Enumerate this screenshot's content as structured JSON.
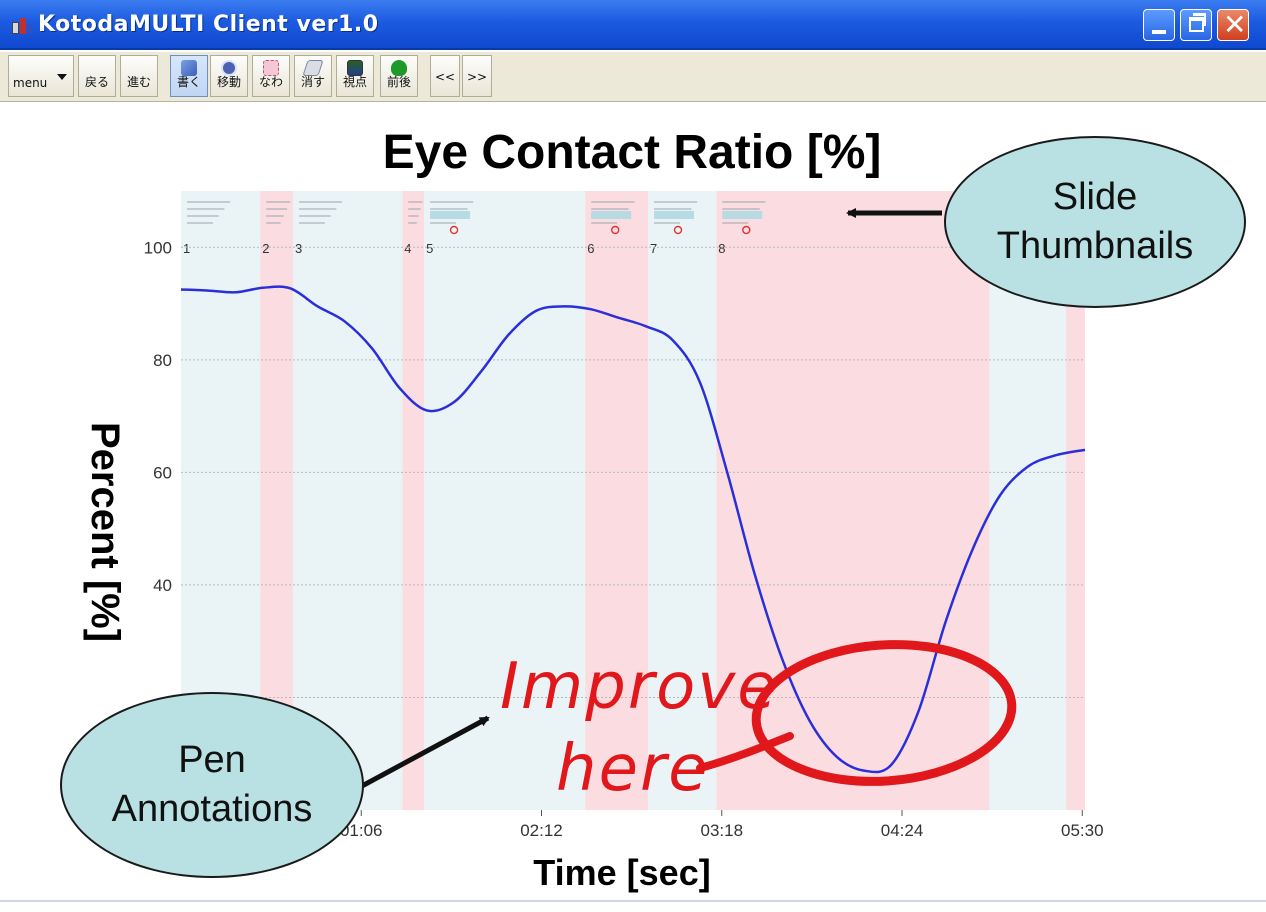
{
  "window": {
    "title": "KotodaMULTI Client ver1.0",
    "controls": {
      "close_glyph": "✕"
    }
  },
  "toolbar": {
    "buttons": [
      {
        "id": "menu",
        "label": "menu",
        "icon": "dropdown-arrow"
      },
      {
        "id": "back",
        "label": "戻る"
      },
      {
        "id": "forward",
        "label": "進む"
      },
      {
        "id": "write",
        "label": "書く",
        "icon": "pen-icon",
        "selected": true
      },
      {
        "id": "move",
        "label": "移動",
        "icon": "move-icon"
      },
      {
        "id": "lasso",
        "label": "なわ",
        "icon": "lasso-icon"
      },
      {
        "id": "erase",
        "label": "消す",
        "icon": "eraser-icon"
      },
      {
        "id": "viewpoint",
        "label": "視点",
        "icon": "viewpoint-icon"
      },
      {
        "id": "order",
        "label": "前後",
        "icon": "order-icon"
      },
      {
        "id": "prev",
        "label": "<<"
      },
      {
        "id": "next",
        "label": ">>"
      }
    ]
  },
  "colors": {
    "line": "#2a2fd8",
    "band_pink": "#fbdde1",
    "band_blue": "#eaf4f7",
    "annotation_red": "#e0181c",
    "bubble_fill": "#b9e0e2"
  },
  "chart_data": {
    "type": "line",
    "title": "Eye Contact Ratio [%]",
    "xlabel": "Time [sec]",
    "ylabel": "Percent [%]",
    "xlim": [
      0,
      331
    ],
    "ylim": [
      0,
      110
    ],
    "x_ticks": [
      {
        "value": 66,
        "label": "01:06"
      },
      {
        "value": 132,
        "label": "02:12"
      },
      {
        "value": 198,
        "label": "03:18"
      },
      {
        "value": 264,
        "label": "04:24"
      },
      {
        "value": 330,
        "label": "05:30"
      }
    ],
    "y_ticks": [
      40,
      60,
      80,
      100
    ],
    "grid": true,
    "slide_bands": [
      {
        "start": 0,
        "end": 29,
        "color": "blue",
        "number": "1"
      },
      {
        "start": 29,
        "end": 41,
        "color": "pink",
        "number": "2"
      },
      {
        "start": 41,
        "end": 81,
        "color": "blue",
        "number": "3"
      },
      {
        "start": 81,
        "end": 89,
        "color": "pink",
        "number": "4"
      },
      {
        "start": 89,
        "end": 148,
        "color": "blue",
        "number": "5"
      },
      {
        "start": 148,
        "end": 171,
        "color": "pink",
        "number": "6"
      },
      {
        "start": 171,
        "end": 196,
        "color": "blue",
        "number": "7"
      },
      {
        "start": 196,
        "end": 296,
        "color": "pink",
        "number": "8"
      },
      {
        "start": 296,
        "end": 324,
        "color": "blue",
        "number": ""
      },
      {
        "start": 324,
        "end": 331,
        "color": "pink",
        "number": ""
      }
    ],
    "series": [
      {
        "x": [
          0,
          10,
          20,
          30,
          40,
          50,
          60,
          70,
          80,
          90,
          100,
          110,
          120,
          130,
          140,
          150,
          160,
          170,
          180,
          190,
          200,
          210,
          220,
          230,
          240,
          250,
          260,
          270,
          280,
          290,
          300,
          310,
          320,
          331
        ],
        "values": [
          92.5,
          92.3,
          92.0,
          92.8,
          92.7,
          89.5,
          86.8,
          82.0,
          75.0,
          71.0,
          72.5,
          78.0,
          84.5,
          88.7,
          89.5,
          89.0,
          87.5,
          86.0,
          83.5,
          76.0,
          60.0,
          42.0,
          27.0,
          16.0,
          9.5,
          7.0,
          8.0,
          17.5,
          33.5,
          46.5,
          56.0,
          61.0,
          63.0,
          64.0
        ]
      }
    ]
  },
  "annotations": {
    "slide_thumbnails": "Slide\nThumbnails",
    "pen_annotations": "Pen\nAnnotations",
    "handwritten_line1": "Improve",
    "handwritten_line2": "here"
  }
}
